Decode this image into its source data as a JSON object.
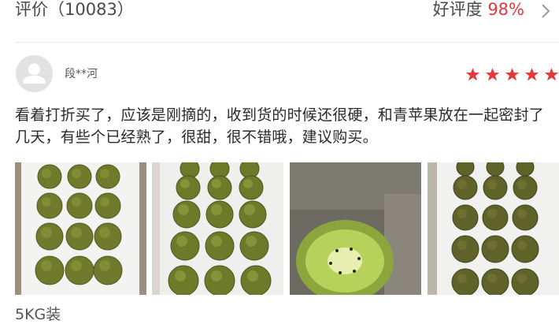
{
  "header": {
    "title": "评价（10083）",
    "rate_label": "好评度",
    "rate_value": "98%",
    "chevron_icon": "chevron-right-icon"
  },
  "review": {
    "avatar_icon": "user-avatar-icon",
    "username": "段**河",
    "rating": 5,
    "rating_max": 5,
    "star_color": "#e4393c",
    "text": "看着打折买了，应该是刚摘的，收到货的时候还很硬，和青苹果放在一起密封了几天，有些个已经熟了，很甜，很不错哦，建议购买。",
    "photos": [
      {
        "name": "photo-kiwis-tray-1"
      },
      {
        "name": "photo-kiwis-tray-2"
      },
      {
        "name": "photo-kiwi-cut"
      },
      {
        "name": "photo-kiwis-tray-3"
      }
    ],
    "spec": "5KG装"
  }
}
